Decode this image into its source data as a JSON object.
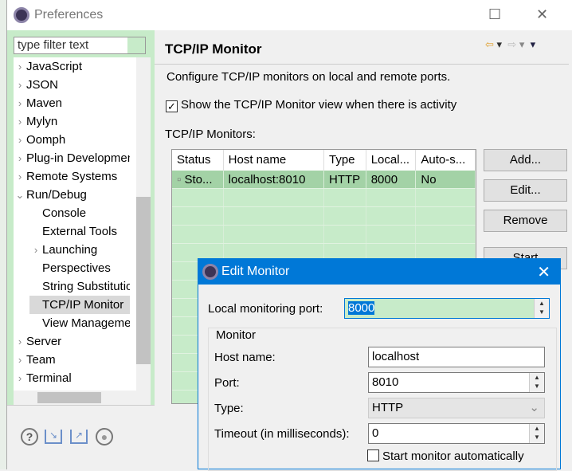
{
  "window": {
    "title": "Preferences",
    "maximize": "☐",
    "close": "✕"
  },
  "filter": {
    "placeholder": "type filter text"
  },
  "tree": [
    {
      "label": "JavaScript",
      "arrow": "›",
      "indent": 0
    },
    {
      "label": "JSON",
      "arrow": "›",
      "indent": 0
    },
    {
      "label": "Maven",
      "arrow": "›",
      "indent": 0
    },
    {
      "label": "Mylyn",
      "arrow": "›",
      "indent": 0
    },
    {
      "label": "Oomph",
      "arrow": "›",
      "indent": 0
    },
    {
      "label": "Plug-in Development",
      "arrow": "›",
      "indent": 0
    },
    {
      "label": "Remote Systems",
      "arrow": "›",
      "indent": 0
    },
    {
      "label": "Run/Debug",
      "arrow": "⌄",
      "indent": 0
    },
    {
      "label": "Console",
      "arrow": "",
      "indent": 1
    },
    {
      "label": "External Tools",
      "arrow": "",
      "indent": 1
    },
    {
      "label": "Launching",
      "arrow": "›",
      "indent": 1
    },
    {
      "label": "Perspectives",
      "arrow": "",
      "indent": 1
    },
    {
      "label": "String Substitution",
      "arrow": "",
      "indent": 1
    },
    {
      "label": "TCP/IP Monitor",
      "arrow": "",
      "indent": 1,
      "selected": true
    },
    {
      "label": "View Management",
      "arrow": "",
      "indent": 1
    },
    {
      "label": "Server",
      "arrow": "›",
      "indent": 0
    },
    {
      "label": "Team",
      "arrow": "›",
      "indent": 0
    },
    {
      "label": "Terminal",
      "arrow": "›",
      "indent": 0
    }
  ],
  "page": {
    "title": "TCP/IP Monitor",
    "description": "Configure TCP/IP monitors on local and remote ports.",
    "show_view_label": "Show the TCP/IP Monitor view when there is activity",
    "show_view_checked": true,
    "monitors_label": "TCP/IP Monitors:",
    "columns": [
      "Status",
      "Host name",
      "Type",
      "Local...",
      "Auto-s..."
    ],
    "rows": [
      [
        "Sto...",
        "localhost:8010",
        "HTTP",
        "8000",
        "No"
      ]
    ],
    "buttons": {
      "add": "Add...",
      "edit": "Edit...",
      "remove": "Remove",
      "start": "Start"
    },
    "nav": {
      "back": "⇦",
      "forward": "⇨",
      "dropdown": "▾"
    }
  },
  "dialog": {
    "title": "Edit Monitor",
    "close": "✕",
    "local_port_label": "Local monitoring port:",
    "local_port_value": "8000",
    "group_label": "Monitor",
    "host_label": "Host name:",
    "host_value": "localhost",
    "port_label": "Port:",
    "port_value": "8010",
    "type_label": "Type:",
    "type_value": "HTTP",
    "timeout_label": "Timeout (in milliseconds):",
    "timeout_value": "0",
    "auto_start_label": "Start monitor automatically",
    "auto_start_checked": false
  },
  "colors": {
    "accent": "#0078d7",
    "green_bg": "#c7ebc9",
    "selected_row": "#a3d2a6"
  }
}
